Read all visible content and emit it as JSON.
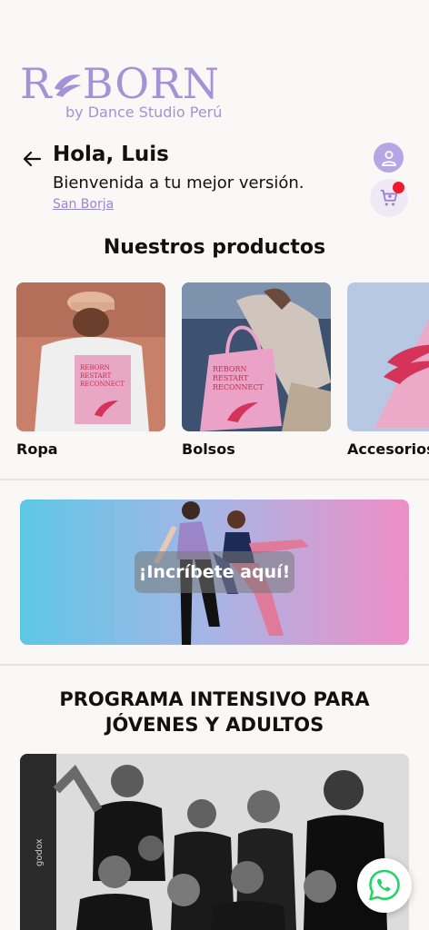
{
  "brand": {
    "logo_text": "REBORN",
    "logo_sub": "by Dance Studio Perú"
  },
  "header": {
    "greeting": "Hola, Luis",
    "subtitle": "Bienvenida a tu mejor versión.",
    "location": "San Borja"
  },
  "products": {
    "title": "Nuestros productos",
    "items": [
      {
        "label": "Ropa",
        "print": "REBORN RESTART RECONNECT"
      },
      {
        "label": "Bolsos",
        "print": "REBORN RESTART RECONNECT"
      },
      {
        "label": "Accesorios"
      }
    ]
  },
  "banner": {
    "cta": "¡Incríbete aquí!"
  },
  "program": {
    "title_line1": "PROGRAMA INTENSIVO PARA",
    "title_line2": "JÓVENES Y ADULTOS"
  },
  "icons": {
    "back": "arrow-left-icon",
    "profile": "user-icon",
    "cart": "cart-icon",
    "whatsapp": "whatsapp-icon"
  },
  "colors": {
    "brand": "#a591d6",
    "link": "#9a86d2",
    "cart_badge": "#ee1a2e",
    "whatsapp": "#25d366",
    "background": "#faf8f6"
  }
}
